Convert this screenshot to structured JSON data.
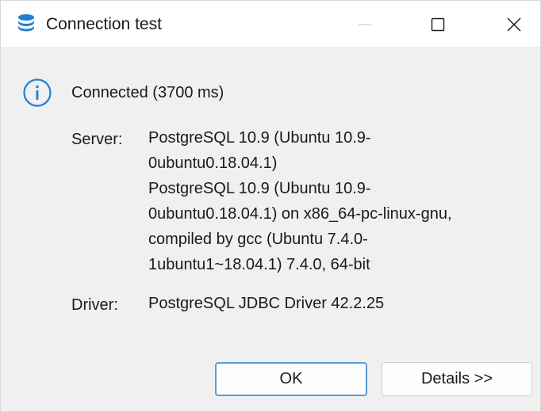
{
  "window": {
    "title": "Connection test",
    "icon": "database-icon",
    "controls": [
      "minimize-icon",
      "maximize-icon",
      "close-icon"
    ]
  },
  "status": {
    "icon": "info-icon",
    "message": "Connected (3700 ms)"
  },
  "server": {
    "label": "Server:",
    "lines": [
      "PostgreSQL 10.9 (Ubuntu 10.9-",
      "0ubuntu0.18.04.1)",
      "PostgreSQL 10.9 (Ubuntu 10.9-",
      "0ubuntu0.18.04.1) on x86_64-pc-linux-gnu,",
      "compiled by gcc (Ubuntu 7.4.0-",
      "1ubuntu1~18.04.1) 7.4.0, 64-bit"
    ]
  },
  "driver": {
    "label": "Driver:",
    "value": "PostgreSQL JDBC Driver 42.2.25"
  },
  "buttons": {
    "ok": "OK",
    "details": "Details >>"
  },
  "colors": {
    "accent": "#1f7fd6",
    "default_button_border": "#5b9bd5"
  }
}
